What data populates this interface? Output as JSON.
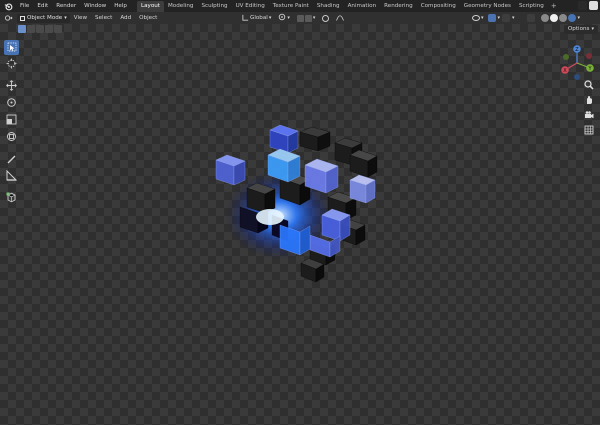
{
  "topbar": {
    "menus": [
      "File",
      "Edit",
      "Render",
      "Window",
      "Help"
    ],
    "workspaces": [
      "Layout",
      "Modeling",
      "Sculpting",
      "UV Editing",
      "Texture Paint",
      "Shading",
      "Animation",
      "Rendering",
      "Compositing",
      "Geometry Nodes",
      "Scripting"
    ],
    "active_workspace": "Layout",
    "add_tab": "+"
  },
  "header": {
    "mode": "Object Mode",
    "menus": [
      "View",
      "Select",
      "Add",
      "Object"
    ],
    "transform_orientation": "Global"
  },
  "viewport": {
    "options_label": "Options"
  },
  "icons": {
    "logo": "blender-logo-icon",
    "editor_type": "viewport-editor-icon",
    "mode": "object-mode-icon",
    "pivot": "pivot-icon",
    "snap": "magnet-icon",
    "proportional": "proportional-edit-icon",
    "select_box": "select-box-icon",
    "cursor": "cursor-icon",
    "move": "move-icon",
    "rotate": "rotate-icon",
    "scale": "scale-icon",
    "transform": "transform-icon",
    "annotate": "annotate-icon",
    "measure": "measure-icon",
    "add_cube": "add-cube-icon",
    "zoom": "zoom-icon",
    "pan": "pan-icon",
    "camera": "camera-icon",
    "ortho": "grid-icon"
  },
  "colors": {
    "accent": "#4772b3",
    "axis_x": "#d24a5a",
    "axis_y": "#79b136",
    "axis_z": "#4f86d6"
  },
  "gizmo": {
    "x": "X",
    "y": "Y",
    "z": "Z"
  }
}
